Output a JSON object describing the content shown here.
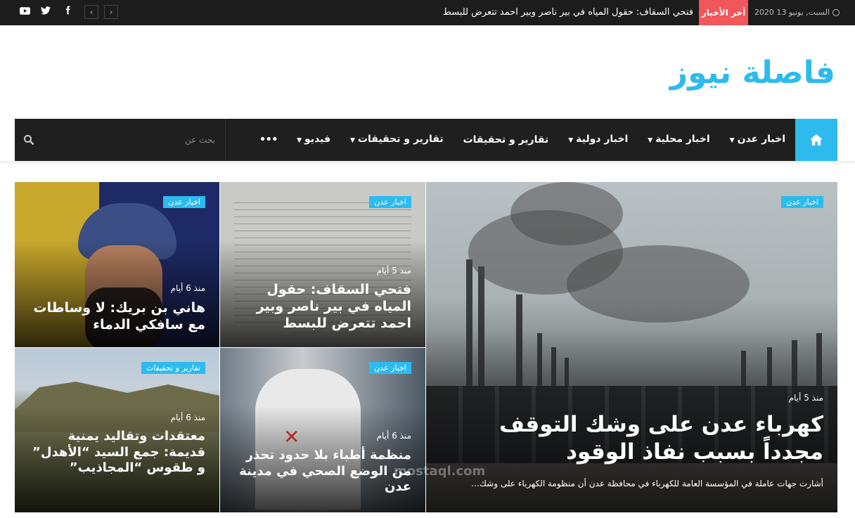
{
  "topbar": {
    "date": "السبت, يونيو 13 2020",
    "breaking_label": "أخر الأخبار",
    "breaking_text": "فتحي السقاف: حقول المياه في بير ناصر وبير احمد تتعرض للبسط",
    "prev": "‹",
    "next": "›",
    "social": {
      "facebook": "f",
      "twitter": "t",
      "youtube": "▶"
    }
  },
  "logo": "فاصلة نيوز",
  "nav": {
    "items": [
      {
        "label": "اخبار عدن",
        "dropdown": true
      },
      {
        "label": "اخبار محلية",
        "dropdown": true
      },
      {
        "label": "اخبار دولية",
        "dropdown": true
      },
      {
        "label": "تقارير و تحقيقات",
        "dropdown": false
      },
      {
        "label": "تقارير و تحقيقات",
        "dropdown": true
      },
      {
        "label": "فيديو",
        "dropdown": true
      }
    ],
    "more": "•••",
    "search_placeholder": "بحث عن"
  },
  "cards": {
    "main": {
      "tag": "اخبار عدن",
      "meta": "منذ 5 أيام",
      "title": "كهرباء عدن على وشك التوقف مجدداً بسبب نفاذ الوقود",
      "excerpt": "أشارت جهات عاملة في المؤسسة العامة للكهرباء في محافظة عدن أن منظومة الكهرباء على وشك…"
    },
    "doc": {
      "tag": "اخبار عدن",
      "meta": "منذ 5 أيام",
      "title": "فتحي السقاف: حقول المياه في بير ناصر وبير احمد تتعرض للبسط"
    },
    "face": {
      "tag": "اخبار عدن",
      "meta": "منذ 6 أيام",
      "title": "هاني بن بريك: لا وساطات مع سافكي الدماء"
    },
    "mountain": {
      "tag": "تقارير و تحقيقات",
      "meta": "منذ 6 أيام",
      "title": "معتقدات وتقاليد يمنية قديمة: جمع السيد “الأهدل” و طقوس “المجاذيب”"
    },
    "msf": {
      "tag": "اخبار عدن",
      "meta": "منذ 6 أيام",
      "title": "منظمة أطباء بلا حدود تحذر من الوضع الصحي في مدينة عدن"
    }
  },
  "watermark": "mostaql.com",
  "colors": {
    "accent": "#2dbbee",
    "breaking": "#f0565a",
    "dark": "#1f1f1f"
  }
}
